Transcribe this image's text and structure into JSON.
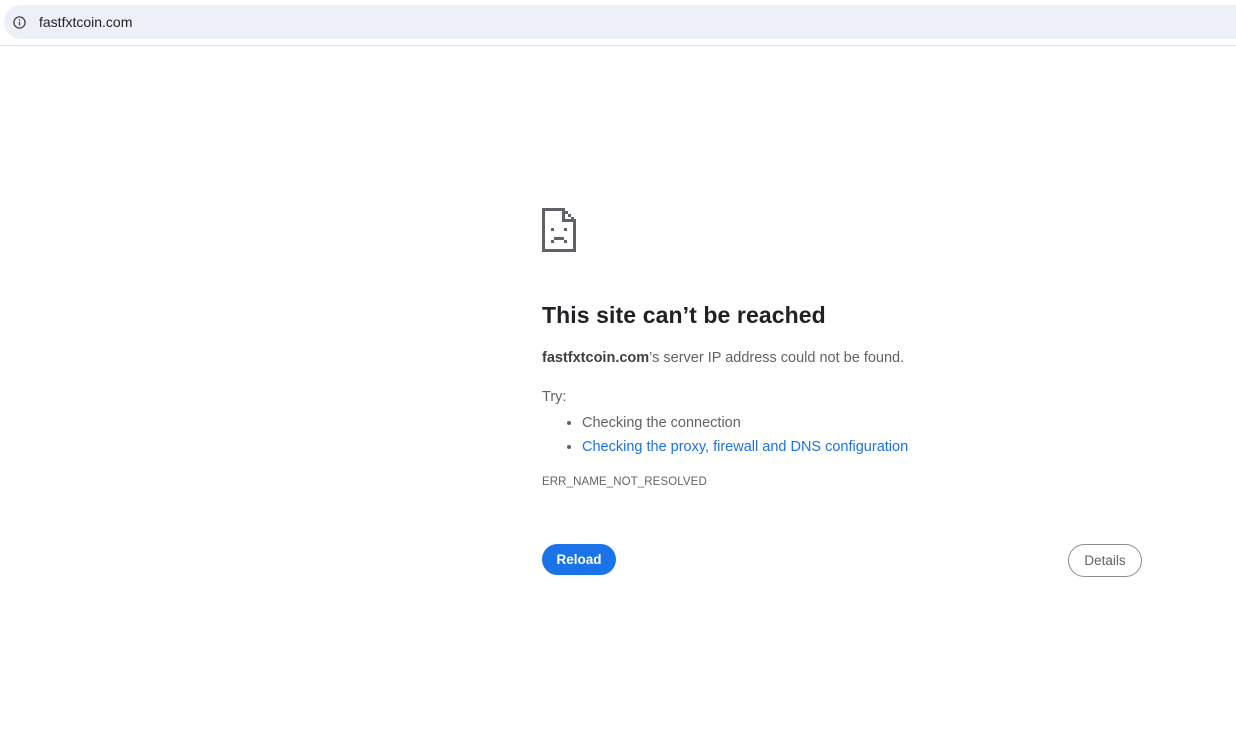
{
  "address_bar": {
    "url": "fastfxtcoin.com",
    "site_info_icon": "info-icon"
  },
  "error_page": {
    "icon": "sad-file-icon",
    "heading": "This site can’t be reached",
    "summary_host": "fastfxtcoin.com",
    "summary_rest": "’s server IP address could not be found.",
    "try_label": "Try:",
    "suggestions": [
      {
        "text": "Checking the connection",
        "is_link": false
      },
      {
        "text": "Checking the proxy, firewall and DNS configuration",
        "is_link": true
      }
    ],
    "error_code": "ERR_NAME_NOT_RESOLVED",
    "reload_label": "Reload",
    "details_label": "Details"
  },
  "colors": {
    "address_bar_bg": "#edf0f8",
    "link": "#1a73e8",
    "primary_button": "#1a73e8",
    "heading_text": "#202124",
    "body_text": "#5f6368"
  }
}
